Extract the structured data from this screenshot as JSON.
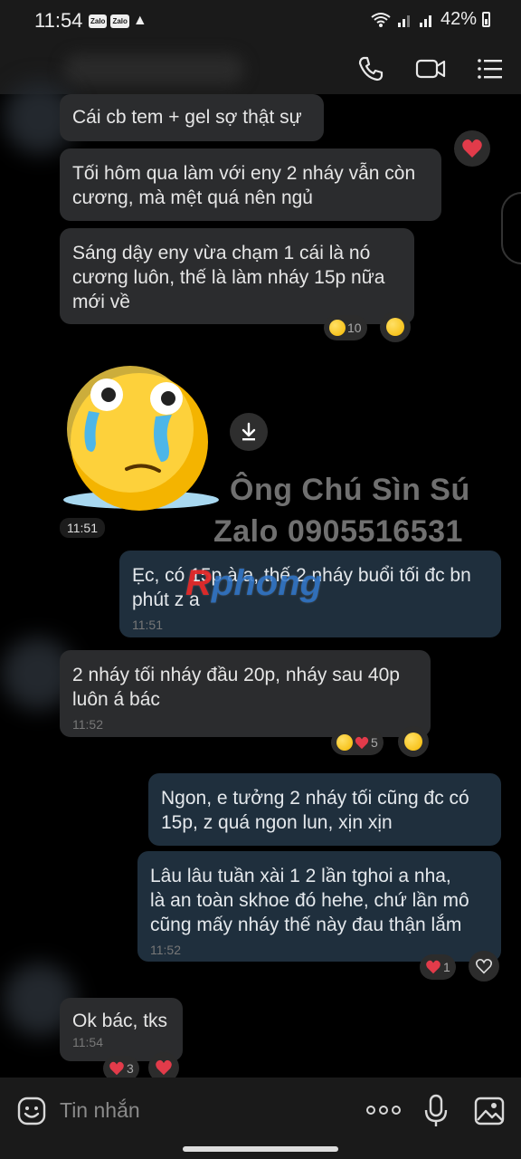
{
  "status_bar": {
    "time": "11:54",
    "apps": [
      "Zalo",
      "Zalo"
    ],
    "battery": "42%"
  },
  "header": {
    "icons": [
      "phone-icon",
      "video-call-icon",
      "menu-icon"
    ]
  },
  "messages": [
    {
      "id": "m1",
      "direction": "in",
      "text": "Cái cb tem + gel sợ thật sự",
      "reactions": [
        "heart"
      ]
    },
    {
      "id": "m2",
      "direction": "in",
      "text": "Tối hôm qua làm với eny 2 nháy vẫn còn\ncương, mà mệt quá nên ngủ"
    },
    {
      "id": "m3",
      "direction": "in",
      "text": "Sáng dậy eny vừa chạm 1 cái là nó\ncương luôn, thế là làm nháy 15p nữa\nmới về",
      "reaction_count": "10"
    },
    {
      "id": "m4",
      "direction": "in",
      "type": "sticker",
      "time": "11:51"
    },
    {
      "id": "m5",
      "direction": "out",
      "text": "Ẹc, có 15p à a, thế 2 nháy buổi tối đc bn\nphút z a",
      "time": "11:51"
    },
    {
      "id": "m6",
      "direction": "in",
      "text": "2 nháy tối nháy đầu 20p, nháy sau 40p\nluôn á bác",
      "time": "11:52",
      "reaction_count": "5"
    },
    {
      "id": "m7",
      "direction": "out",
      "text": "Ngon, e tưởng 2 nháy tối cũng đc có\n15p, z quá ngon lun, xịn xịn"
    },
    {
      "id": "m8",
      "direction": "out",
      "text": "Lâu lâu tuần xài 1 2 lần tghoi a nha,\nlà an toàn skhoe đó hehe, chứ lần mô\ncũng mấy nháy thế này đau thận lắm",
      "time": "11:52",
      "reaction_count": "1"
    },
    {
      "id": "m9",
      "direction": "in",
      "text": "Ok bác, tks",
      "time": "11:54",
      "reaction_count": "3"
    }
  ],
  "watermark": {
    "line1": "Ông Chú Sìn Sú",
    "line2": "Zalo 0905516531",
    "brand_r": "R",
    "brand_rest": "phong"
  },
  "input": {
    "placeholder": "Tin nhắn",
    "icons": [
      "emoji-icon",
      "more-icon",
      "mic-icon",
      "image-icon"
    ]
  },
  "colors": {
    "incoming_bubble": "#2b2c2e",
    "outgoing_bubble": "#1f2f3d",
    "background": "#000000",
    "heart": "#e23b4a"
  }
}
